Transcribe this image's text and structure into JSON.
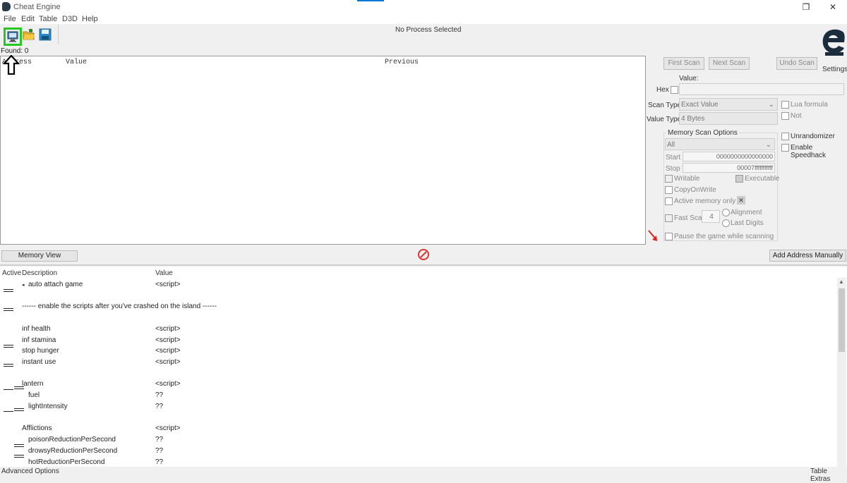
{
  "window": {
    "title": "Cheat Engine",
    "restore_glyph": "❐",
    "close_glyph": "✕"
  },
  "menu": [
    "File",
    "Edit",
    "Table",
    "D3D",
    "Help"
  ],
  "toolbar": {
    "process_label": "No Process Selected"
  },
  "logo": {
    "settings_label": "Settings"
  },
  "results": {
    "found_label": "Found: 0",
    "columns": [
      "Address",
      "Value",
      "Previous"
    ]
  },
  "scan": {
    "first_scan": "First Scan",
    "next_scan": "Next Scan",
    "undo_scan": "Undo Scan",
    "value_label": "Value:",
    "hex_label": "Hex",
    "scan_type_label": "Scan Type",
    "scan_type_value": "Exact Value",
    "value_type_label": "Value Type",
    "value_type_value": "4 Bytes",
    "lua_formula": "Lua formula",
    "not_label": "Not",
    "unrandomizer": "Unrandomizer",
    "enable_speedhack": "Enable Speedhack",
    "memory_options": {
      "title": "Memory Scan Options",
      "region_value": "All",
      "start_label": "Start",
      "start_value": "0000000000000000",
      "stop_label": "Stop",
      "stop_value": "00007fffffffffff",
      "writable": "Writable",
      "executable": "Executable",
      "copy_on_write": "CopyOnWrite",
      "active_memory_only": "Active memory only",
      "fast_scan": "Fast Scan",
      "fast_scan_value": "4",
      "alignment": "Alignment",
      "last_digits": "Last Digits",
      "pause_game": "Pause the game while scanning"
    }
  },
  "middle": {
    "memory_view": "Memory View",
    "add_manually": "Add Address Manually"
  },
  "table": {
    "headers": {
      "active": "Active",
      "description": "Description",
      "value": "Value"
    },
    "rows": [
      {
        "description": "auto attach game",
        "value": "<script>"
      },
      {
        "description": "------ enable the scripts after you've crashed on the island ------",
        "value": ""
      },
      {
        "description": "inf health",
        "value": "<script>"
      },
      {
        "description": "inf stamina",
        "value": "<script>"
      },
      {
        "description": "stop hunger",
        "value": "<script>"
      },
      {
        "description": "instant use",
        "value": "<script>"
      },
      {
        "description": "lantern",
        "value": "<script>"
      },
      {
        "description": "fuel",
        "value": "??"
      },
      {
        "description": "lightIntensity",
        "value": "??"
      },
      {
        "description": "Afflictions",
        "value": "<script>"
      },
      {
        "description": "poisonReductionPerSecond",
        "value": "??"
      },
      {
        "description": "drowsyReductionPerSecond",
        "value": "??"
      },
      {
        "description": "hotReductionPerSecond",
        "value": "??"
      }
    ]
  },
  "status": {
    "advanced_options": "Advanced Options",
    "table_extras": "Table Extras"
  },
  "colors": {
    "highlight": "#28c820",
    "accent": "#0078d7",
    "stop": "#dd3333"
  }
}
